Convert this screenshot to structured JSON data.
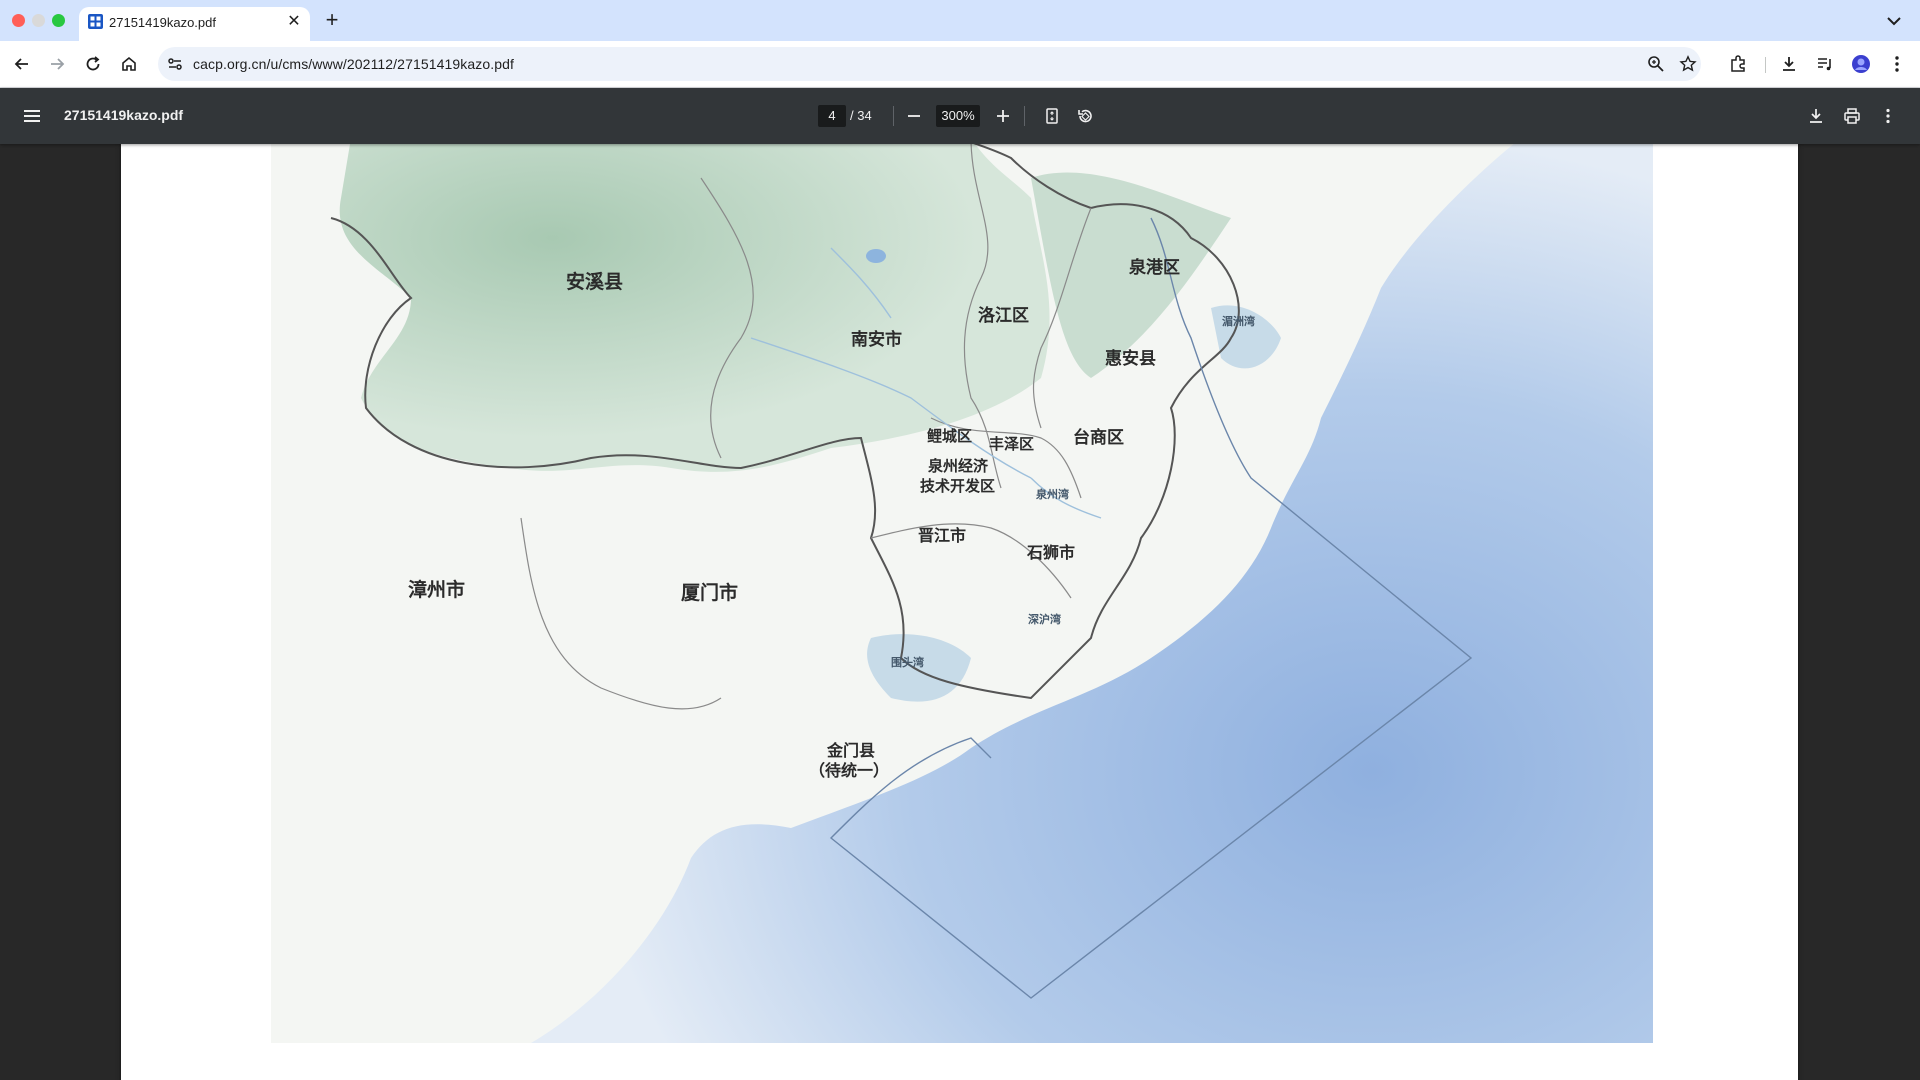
{
  "browser": {
    "tab": {
      "title": "27151419kazo.pdf"
    },
    "address_bar": {
      "url": "cacp.org.cn/u/cms/www/202112/27151419kazo.pdf"
    }
  },
  "pdf_viewer": {
    "file_name": "27151419kazo.pdf",
    "current_page": "4",
    "total_pages": "/ 34",
    "zoom": "300%"
  },
  "map": {
    "labels": {
      "anxi": "安溪县",
      "nanan": "南安市",
      "luojiang": "洛江区",
      "quangang": "泉港区",
      "huian": "惠安县",
      "licheng": "鲤城区",
      "fengze": "丰泽区",
      "taishang": "台商区",
      "quanzhou_etdz_1": "泉州经济",
      "quanzhou_etdz_2": "技术开发区",
      "jinjiang": "晋江市",
      "shishi": "石狮市",
      "zhangzhou": "漳州市",
      "xiamen": "厦门市",
      "kinmen_1": "金门县",
      "kinmen_2": "（待统一）",
      "bay_meizhou": "湄洲湾",
      "bay_quanzhou": "泉州湾",
      "bay_shenhu": "深沪湾",
      "bay_weitou": "围头湾"
    },
    "colors": {
      "sea": "#a9c4e6",
      "mountain": "#b9d4c2",
      "land": "#f7f8f6",
      "boundary": "#555555"
    }
  }
}
